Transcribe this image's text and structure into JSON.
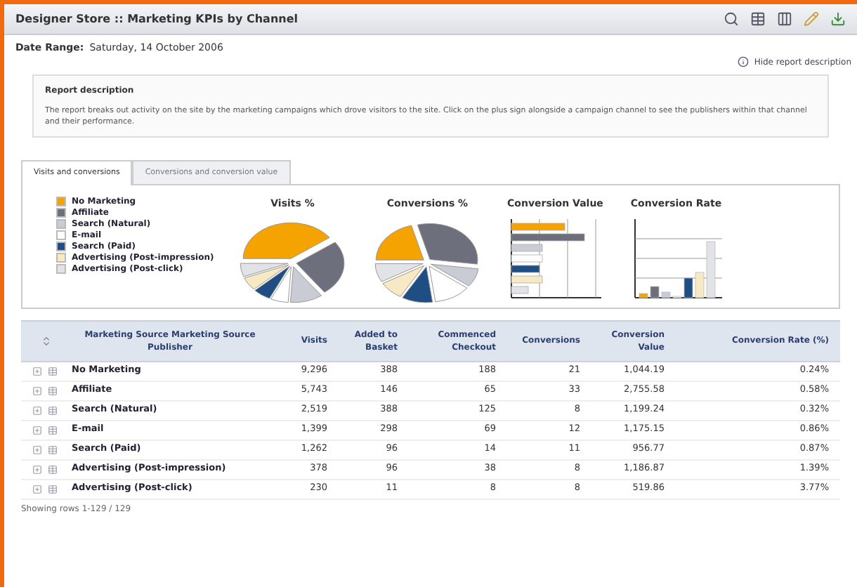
{
  "window": {
    "title": "Designer Store :: Marketing KPIs by Channel"
  },
  "date_range": {
    "label": "Date Range:",
    "value": "Saturday, 14 October 2006"
  },
  "hide_link": "Hide report description",
  "description": {
    "title": "Report description",
    "text": "The report breaks out activity on the site by the marketing campaigns which drove visitors to the site. Click on the plus sign alongside a campaign channel to see the publishers within that channel and their performance."
  },
  "tabs": [
    {
      "label": "Visits and conversions",
      "selected": true
    },
    {
      "label": "Conversions and conversion value",
      "selected": false
    }
  ],
  "legend": [
    {
      "label": "No Marketing",
      "color": "#f5a300"
    },
    {
      "label": "Affiliate",
      "color": "#6d6f7d"
    },
    {
      "label": "Search (Natural)",
      "color": "#c9ccd4"
    },
    {
      "label": "E-mail",
      "color": "#ffffff"
    },
    {
      "label": "Search (Paid)",
      "color": "#1f4e85"
    },
    {
      "label": "Advertising (Post-impression)",
      "color": "#f7e9c4"
    },
    {
      "label": "Advertising (Post-click)",
      "color": "#e2e3e6"
    }
  ],
  "charts": [
    {
      "title": "Visits %",
      "kind": "pie"
    },
    {
      "title": "Conversions %",
      "kind": "pie"
    },
    {
      "title": "Conversion Value",
      "kind": "bars"
    },
    {
      "title": "Conversion Rate",
      "kind": "columns"
    }
  ],
  "table": {
    "columns": [
      "Marketing Source Marketing Source Publisher",
      "Visits",
      "Added to Basket",
      "Commenced Checkout",
      "Conversions",
      "Conversion Value",
      "Conversion Rate (%)"
    ],
    "rows": [
      {
        "cells": [
          "No Marketing",
          "9,296",
          "388",
          "188",
          "21",
          "1,044.19",
          "0.24%"
        ]
      },
      {
        "cells": [
          "Affiliate",
          "5,743",
          "146",
          "65",
          "33",
          "2,755.58",
          "0.58%"
        ]
      },
      {
        "cells": [
          "Search (Natural)",
          "2,519",
          "388",
          "125",
          "8",
          "1,199.24",
          "0.32%"
        ]
      },
      {
        "cells": [
          "E-mail",
          "1,399",
          "298",
          "69",
          "12",
          "1,175.15",
          "0.86%"
        ]
      },
      {
        "cells": [
          "Search (Paid)",
          "1,262",
          "96",
          "14",
          "11",
          "956.77",
          "0.87%"
        ]
      },
      {
        "cells": [
          "Advertising (Post-impression)",
          "378",
          "96",
          "38",
          "8",
          "1,186.87",
          "1.39%"
        ]
      },
      {
        "cells": [
          "Advertising (Post-click)",
          "230",
          "11",
          "8",
          "8",
          "519.86",
          "3.77%"
        ]
      }
    ]
  },
  "footer": "Showing rows 1-129 / 129"
}
